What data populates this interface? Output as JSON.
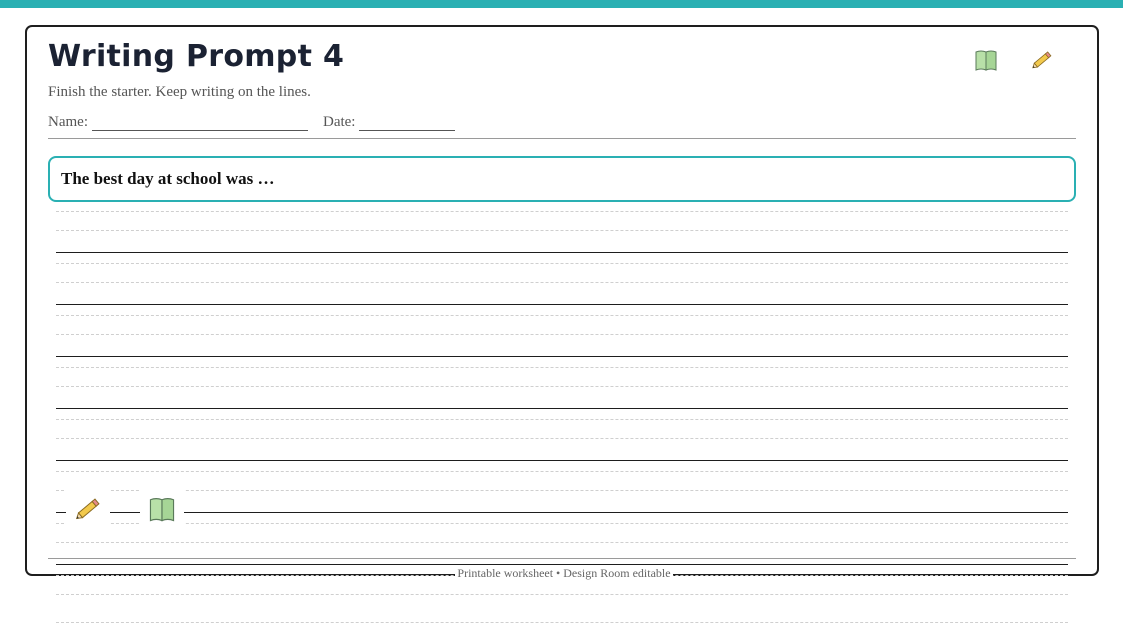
{
  "header": {
    "title": "Writing Prompt 4",
    "subtitle": "Finish the starter. Keep writing on the lines.",
    "name_label": "Name:",
    "date_label": "Date:",
    "icons": [
      "book-icon",
      "pencil-icon"
    ]
  },
  "prompt": {
    "text": "The best day at school was …"
  },
  "bottom_icons": [
    "pencil-icon",
    "book-icon"
  ],
  "footer": {
    "text": "Printable worksheet • Design Room editable"
  },
  "colors": {
    "accent": "#2ab0b3",
    "title": "#1b2233",
    "book": "#b8e0a8",
    "pencil": "#f2c94c"
  }
}
